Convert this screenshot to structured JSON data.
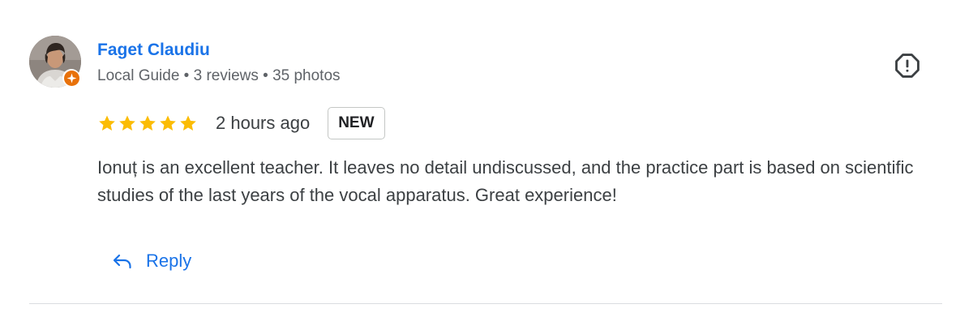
{
  "author": {
    "name": "Faget Claudiu",
    "meta": "Local Guide • 3 reviews • 35 photos",
    "avatar_icon": "profile-photo",
    "badge_icon": "local-guide-star-icon",
    "badge_color": "#e8710a"
  },
  "review": {
    "rating": 5,
    "rating_max": 5,
    "time": "2 hours ago",
    "badge": "NEW",
    "text": "Ionuț is an excellent teacher. It leaves no detail undiscussed, and the practice part is based on scientific studies of the last years of the vocal apparatus. Great experience!"
  },
  "actions": {
    "reply_label": "Reply",
    "reply_icon": "reply-arrow-icon",
    "report_icon": "report-icon"
  },
  "colors": {
    "link_blue": "#1a73e8",
    "star_yellow": "#fbbc04",
    "meta_gray": "#5f6368",
    "text_dark": "#3c4043"
  }
}
